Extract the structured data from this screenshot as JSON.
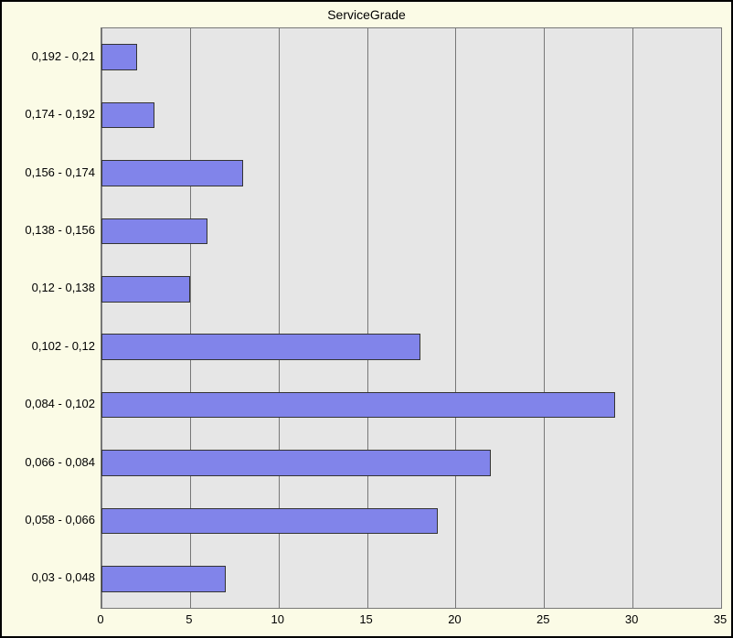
{
  "chart_data": {
    "type": "bar",
    "orientation": "horizontal",
    "title": "ServiceGrade",
    "xlabel": "",
    "ylabel": "",
    "x_ticks": [
      0,
      5,
      10,
      15,
      20,
      25,
      30,
      35
    ],
    "xlim": [
      0,
      35
    ],
    "categories": [
      "0,192 - 0,21",
      "0,174 - 0,192",
      "0,156 - 0,174",
      "0,138 - 0,156",
      "0,12 - 0,138",
      "0,102 - 0,12",
      "0,084 - 0,102",
      "0,066 - 0,084",
      "0,058 - 0,066",
      "0,03 - 0,048"
    ],
    "values": [
      2,
      3,
      8,
      6,
      5,
      18,
      29,
      22,
      19,
      7
    ],
    "bar_color": "#8184ea",
    "plot_bg": "#e6e6e6",
    "frame_bg": "#fbfbe6"
  }
}
